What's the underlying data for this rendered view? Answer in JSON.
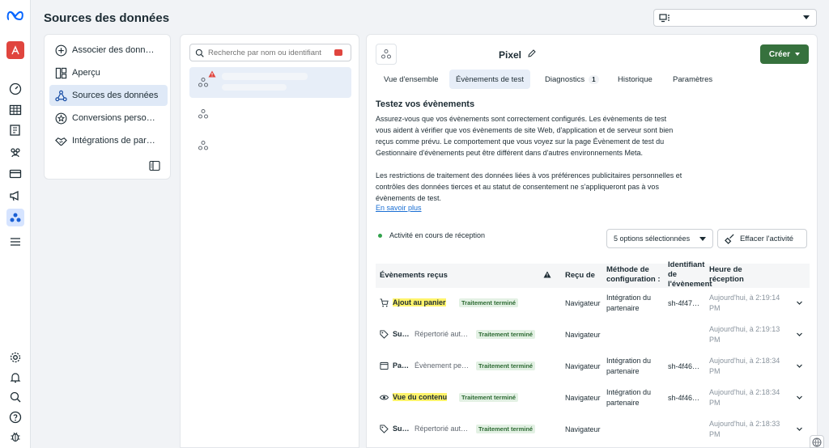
{
  "header": {
    "title": "Sources des données",
    "business_select": ""
  },
  "nav": {
    "items": [
      {
        "label": "Associer des donn…",
        "icon": "plus-circle-icon"
      },
      {
        "label": "Aperçu",
        "icon": "overview-icon"
      },
      {
        "label": "Sources des données",
        "icon": "data-sources-icon",
        "active": true
      },
      {
        "label": "Conversions perso…",
        "icon": "star-icon"
      },
      {
        "label": "Intégrations de par…",
        "icon": "handshake-icon"
      }
    ]
  },
  "sources": {
    "search_placeholder": "Recherche par nom ou identifiant"
  },
  "main": {
    "title": "Pixel",
    "create_label": "Créer",
    "tabs": [
      {
        "label": "Vue d'ensemble"
      },
      {
        "label": "Évènements de test",
        "active": true
      },
      {
        "label": "Diagnostics",
        "badge": "1"
      },
      {
        "label": "Historique"
      },
      {
        "label": "Paramètres"
      }
    ],
    "section_title": "Testez vos évènements",
    "para1": [
      "Assurez-vous que vos évènements sont correctement configurés. Les évènements de test",
      "vous aident à vérifier que vos évènements de site Web, d'application et de serveur sont bien",
      "reçus comme prévu. Le comportement que vous voyez sur la page Évènement de test du",
      "Gestionnaire d'évènements peut être différent dans d'autres environnements Meta."
    ],
    "para2": [
      "Les restrictions de traitement des données liées à vos préférences publicitaires personnelles et",
      "contrôles des données tierces et au statut de consentement ne s'appliqueront pas à vos",
      "évènements de test."
    ],
    "learn_more": "En savoir plus",
    "activity": "Activité en cours de réception",
    "options": "5 options sélectionnées",
    "clear": "Effacer l'activité"
  },
  "table": {
    "headers": {
      "events": "Évènements reçus",
      "received_from": "Reçu de",
      "method_1": "Méthode de",
      "method_2": "configuration :",
      "id_1": "Identifiant",
      "id_2": "de",
      "id_3": "l'évènement",
      "time_1": "Heure de",
      "time_2": "réception"
    },
    "rows": [
      {
        "icon": "cart-icon",
        "name": "Ajout au panier",
        "desc": "",
        "status": "Traitement terminé",
        "from": "Navigateur",
        "method1": "Intégration du",
        "method2": "partenaire",
        "id": "sh-4f47…",
        "time1": "Aujourd'hui, à 2:19:14",
        "time2": "PM"
      },
      {
        "icon": "tag-icon",
        "name": "Su…",
        "desc": "Répertorié aut…",
        "status": "Traitement terminé",
        "from": "Navigateur",
        "method1": "",
        "method2": "",
        "id": "",
        "time1": "Aujourd'hui, à 2:19:13",
        "time2": "PM"
      },
      {
        "icon": "page-icon",
        "name": "Pa…",
        "desc": "Évènement pe…",
        "status": "Traitement terminé",
        "from": "Navigateur",
        "method1": "Intégration du",
        "method2": "partenaire",
        "id": "sh-4f46…",
        "time1": "Aujourd'hui, à 2:18:34",
        "time2": "PM"
      },
      {
        "icon": "eye-icon",
        "name": "Vue du contenu",
        "desc": "",
        "status": "Traitement terminé",
        "from": "Navigateur",
        "method1": "Intégration du",
        "method2": "partenaire",
        "id": "sh-4f46…",
        "time1": "Aujourd'hui, à 2:18:34",
        "time2": "PM"
      },
      {
        "icon": "tag-icon",
        "name": "Su…",
        "desc": "Répertorié aut…",
        "status": "Traitement terminé",
        "from": "Navigateur",
        "method1": "",
        "method2": "",
        "id": "",
        "time1": "Aujourd'hui, à 2:18:33",
        "time2": "PM"
      }
    ]
  }
}
